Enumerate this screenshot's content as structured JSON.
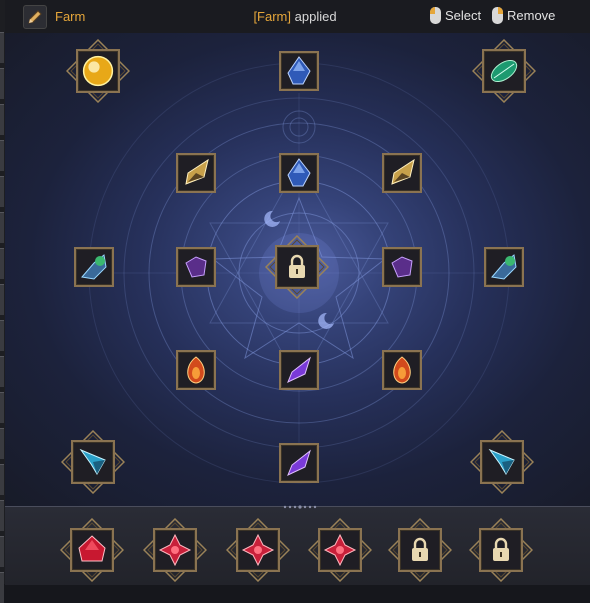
{
  "header": {
    "preset_name": "Farm",
    "applied_tag": "[Farm]",
    "applied_text": "applied",
    "select_label": "Select",
    "remove_label": "Remove"
  },
  "colors": {
    "accent": "#e5a63a",
    "frame": "#8a7351",
    "board": "#26305a"
  },
  "board_slots": [
    {
      "name": "corner-gem-gold",
      "gem": "gold-sphere"
    },
    {
      "name": "top-gem-blue",
      "gem": "blue-crystal"
    },
    {
      "name": "corner-gem-green",
      "gem": "green-leaf"
    },
    {
      "name": "gem-amber-left",
      "gem": "amber-crystal"
    },
    {
      "name": "gem-blue-center",
      "gem": "blue-crystal"
    },
    {
      "name": "gem-amber-right",
      "gem": "amber-crystal"
    },
    {
      "name": "gem-teal-left",
      "gem": "teal-cluster"
    },
    {
      "name": "gem-purple-left",
      "gem": "purple-stone"
    },
    {
      "name": "center-lock",
      "gem": "lock"
    },
    {
      "name": "gem-purple-right",
      "gem": "purple-stone"
    },
    {
      "name": "gem-teal-right",
      "gem": "teal-cluster"
    },
    {
      "name": "gem-fire-left",
      "gem": "fire-drop"
    },
    {
      "name": "gem-violet-center",
      "gem": "violet-shard"
    },
    {
      "name": "gem-fire-right",
      "gem": "fire-drop"
    },
    {
      "name": "corner-gem-cyan-left",
      "gem": "cyan-shard"
    },
    {
      "name": "gem-violet-bottom",
      "gem": "violet-shard"
    },
    {
      "name": "corner-gem-cyan-right",
      "gem": "cyan-shard"
    }
  ],
  "bottom_slots": [
    {
      "name": "bottom-gem-ruby",
      "gem": "ruby"
    },
    {
      "name": "bottom-gem-red-star-1",
      "gem": "red-star"
    },
    {
      "name": "bottom-gem-red-star-2",
      "gem": "red-star"
    },
    {
      "name": "bottom-gem-red-star-3",
      "gem": "red-star"
    },
    {
      "name": "bottom-lock-1",
      "gem": "lock"
    },
    {
      "name": "bottom-lock-2",
      "gem": "lock"
    }
  ]
}
